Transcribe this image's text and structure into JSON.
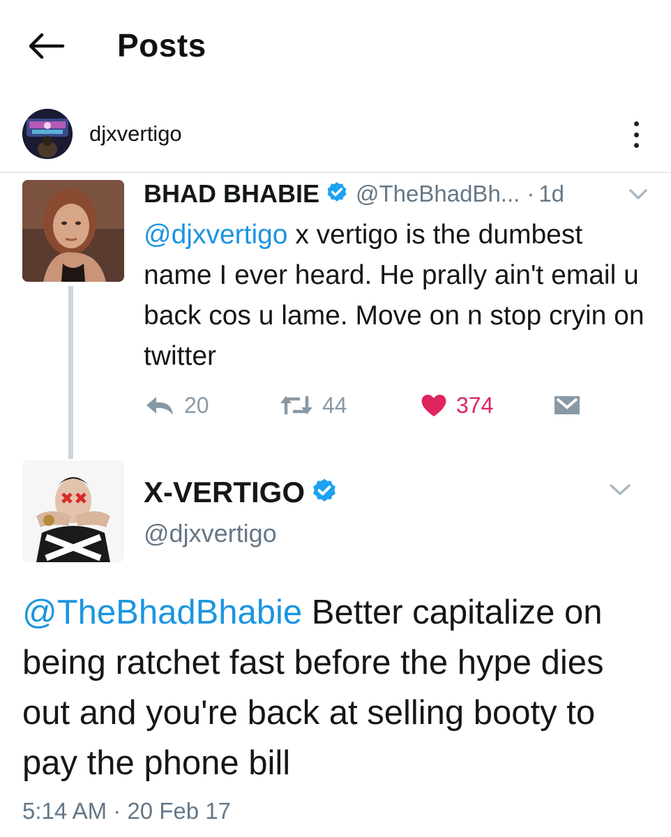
{
  "header": {
    "title": "Posts"
  },
  "post": {
    "username": "djxvertigo"
  },
  "reply_parent": {
    "name": "BHAD BHABIE",
    "handle": "@TheBhadBh...",
    "separator": "·",
    "time": "1d",
    "mention": "@djxvertigo",
    "text": " x vertigo is the dumbest name I ever heard. He prally ain't email u back cos u lame. Move on n stop cryin on twitter",
    "reply_count": "20",
    "retweet_count": "44",
    "like_count": "374",
    "icons": [
      "reply-icon",
      "retweet-icon",
      "heart-icon",
      "direct-message-icon",
      "verified-badge-icon",
      "chevron-down-icon"
    ]
  },
  "main_tweet": {
    "name": "X-VERTIGO",
    "handle": "@djxvertigo",
    "mention": "@TheBhadBhabie",
    "text": " Better capitalize on being ratchet fast before the hype dies out and you're back at selling booty to pay the phone bill",
    "timestamp": "5:14 AM · 20 Feb 17"
  },
  "colors": {
    "link": "#1b95e0",
    "like": "#e0245e",
    "muted": "#657786",
    "verified": "#1da1f2",
    "thread_line": "#cdd6dd"
  }
}
